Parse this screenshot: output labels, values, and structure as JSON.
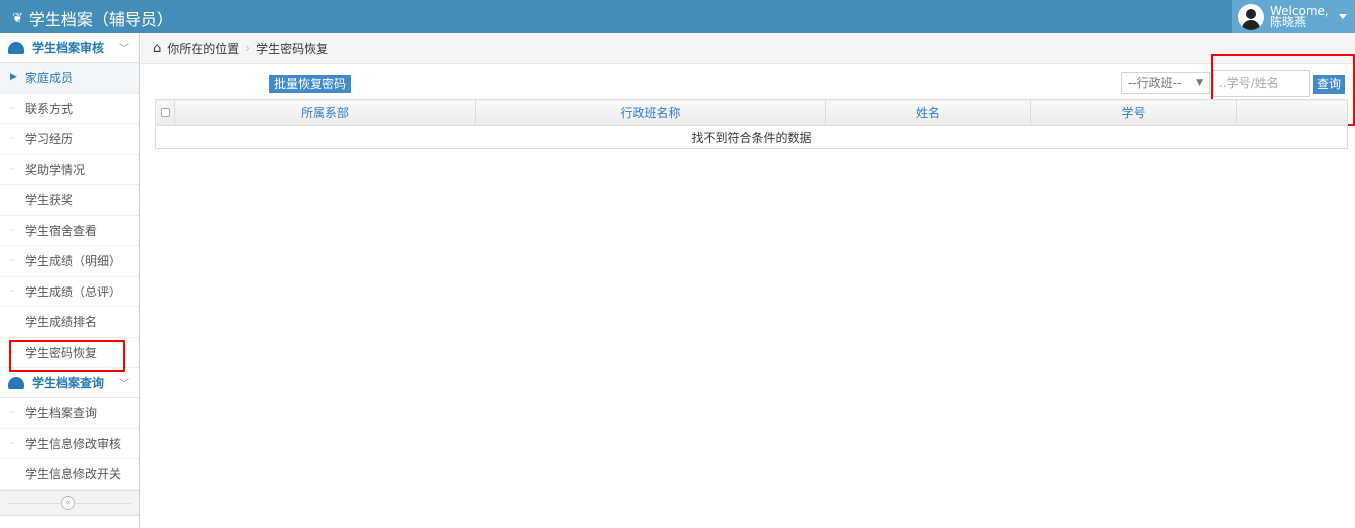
{
  "header": {
    "title": "学生档案（辅导员）",
    "welcome": "Welcome,",
    "user": "陈晓燕"
  },
  "sidebar": {
    "sections": [
      {
        "label": "学生档案审核",
        "items": [
          "家庭成员",
          "联系方式",
          "学习经历",
          "奖助学情况",
          "学生获奖",
          "学生宿舍查看",
          "学生成绩（明细）",
          "学生成绩（总评）",
          "学生成绩排名",
          "学生密码恢复"
        ]
      },
      {
        "label": "学生档案查询",
        "items": [
          "学生档案查询",
          "学生信息修改审核",
          "学生信息修改开关"
        ]
      }
    ],
    "collapse": "«"
  },
  "breadcrumb": {
    "home": "你所在的位置",
    "current": "学生密码恢复"
  },
  "toolbar": {
    "batch_button": "批量恢复密码",
    "class_select": "--行政班--",
    "search_placeholder": "..学号/姓名",
    "query_button": "查询"
  },
  "table": {
    "columns": [
      "所属系部",
      "行政班名称",
      "姓名",
      "学号",
      ""
    ],
    "empty": "找不到符合条件的数据"
  }
}
